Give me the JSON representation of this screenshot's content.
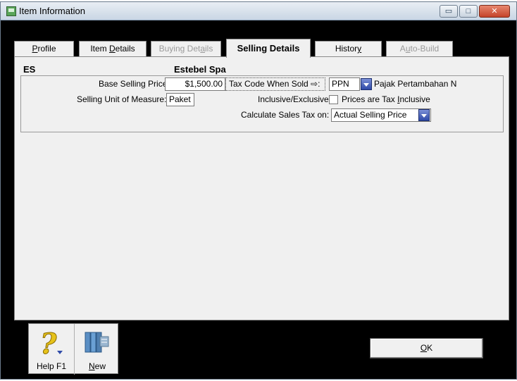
{
  "window": {
    "title": "Item Information",
    "controls": {
      "minimize": "▭",
      "maximize": "□",
      "close": "✕"
    }
  },
  "tabs": [
    {
      "label_pre": "",
      "label_key": "P",
      "label_post": "rofile",
      "state": "normal"
    },
    {
      "label_pre": "Item ",
      "label_key": "D",
      "label_post": "etails",
      "state": "normal"
    },
    {
      "label_pre": "Buying Det",
      "label_key": "a",
      "label_post": "ils",
      "state": "disabled"
    },
    {
      "label_pre": "Selling Details",
      "label_key": "",
      "label_post": "",
      "state": "active"
    },
    {
      "label_pre": "Histor",
      "label_key": "y",
      "label_post": "",
      "state": "normal"
    },
    {
      "label_pre": "A",
      "label_key": "u",
      "label_post": "to-Build",
      "state": "disabled"
    }
  ],
  "item": {
    "code": "ES",
    "name": "Estebel Spa"
  },
  "selling": {
    "base_price_label": "Base Selling Price:",
    "base_price_value": "$1,500.00",
    "unit_label": "Selling Unit of Measure:",
    "unit_value": "Paket",
    "tax_code_button": "Tax Code When Sold ⇨:",
    "tax_code_value": "PPN",
    "tax_code_desc": "Pajak Pertambahan N",
    "inclusive_label": "Inclusive/Exclusive:",
    "inclusive_checkbox_pre": "Prices are Tax ",
    "inclusive_checkbox_key": "I",
    "inclusive_checkbox_post": "nclusive",
    "inclusive_checked": false,
    "calc_label": "Calculate Sales Tax on:",
    "calc_value": "Actual Selling Price"
  },
  "toolbar": {
    "help_label": "Help F1",
    "help_icon": "question-mark-icon",
    "new_key": "N",
    "new_post": "ew",
    "new_icon": "new-item-icon"
  },
  "ok_button": {
    "key": "O",
    "post": "K"
  },
  "colors": {
    "window_bg": "#000000",
    "panel_bg": "#f0f0f0",
    "dropdown_blue": "#2f4aa8",
    "help_icon_yellow": "#e6c21a"
  }
}
